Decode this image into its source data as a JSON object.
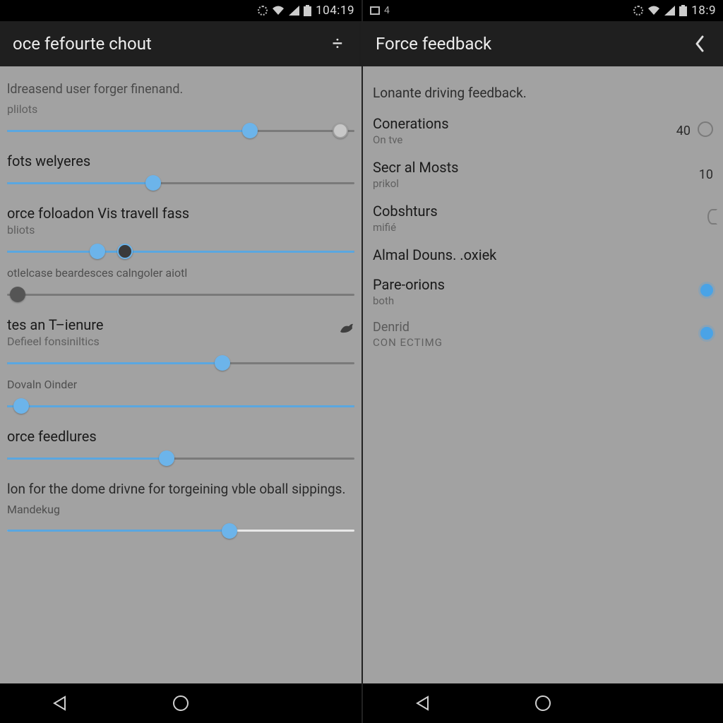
{
  "left": {
    "status": {
      "time": "104:19"
    },
    "appbar": {
      "title": "oce fefourte chout",
      "action_glyph": "÷"
    },
    "section_header": "ldreasend user forger finenand.",
    "rows": [
      {
        "label": "plilots",
        "type": "slider2",
        "fill": 70,
        "thumb1": 70,
        "thumb2": 96
      },
      {
        "label": "fots welyeres",
        "type": "slider",
        "fill": 42,
        "thumb": 42
      },
      {
        "label": "orce foloadon Vis travell fass",
        "sub": "bliots",
        "type": "slider_dualdark",
        "fill": 100,
        "thumb1": 26,
        "thumb2": 34
      },
      {
        "label": "otlelcase beardesces calngoler aiotl",
        "type": "slider_greythumb",
        "fill": 0,
        "thumb": 3
      },
      {
        "label": "tes an T–ienure",
        "sub": "Defieel fonsiniltics",
        "type": "slider",
        "fill": 62,
        "thumb": 62,
        "trailing_icon": "bird"
      },
      {
        "label": "Dovaln Oinder",
        "type": "slider",
        "fill": 100,
        "thumb": 4
      },
      {
        "label": "orce feedlures",
        "type": "slider",
        "fill": 46,
        "thumb": 46
      }
    ],
    "footer_text": "lon for the dome drivne for torgeining vble oball sippings.",
    "footer_row": {
      "label": "Mandekug",
      "type": "slider",
      "fill": 64,
      "thumb": 64,
      "track_right_white": true
    }
  },
  "right": {
    "status": {
      "left_indicator": "4",
      "time": "18:9"
    },
    "appbar": {
      "title": "Force feedback",
      "back": true
    },
    "section_header": "Lonante driving feedback.",
    "items": [
      {
        "title": "Conerations",
        "sub": "On tve",
        "value": "40",
        "ctrl": "radio-off"
      },
      {
        "title": "Secr al Mosts",
        "sub": "prikol",
        "value": "10"
      },
      {
        "title": "Cobshturs",
        "sub": "mifié",
        "ctrl": "radio-off-edge"
      },
      {
        "title": "Almal Douns. .oxiek"
      },
      {
        "title": "Pare-orions",
        "sub": "both",
        "ctrl": "radio-on"
      },
      {
        "title": "Denrid",
        "sub": "CON ECTIMG",
        "ctrl": "radio-on",
        "muted": true
      }
    ]
  }
}
